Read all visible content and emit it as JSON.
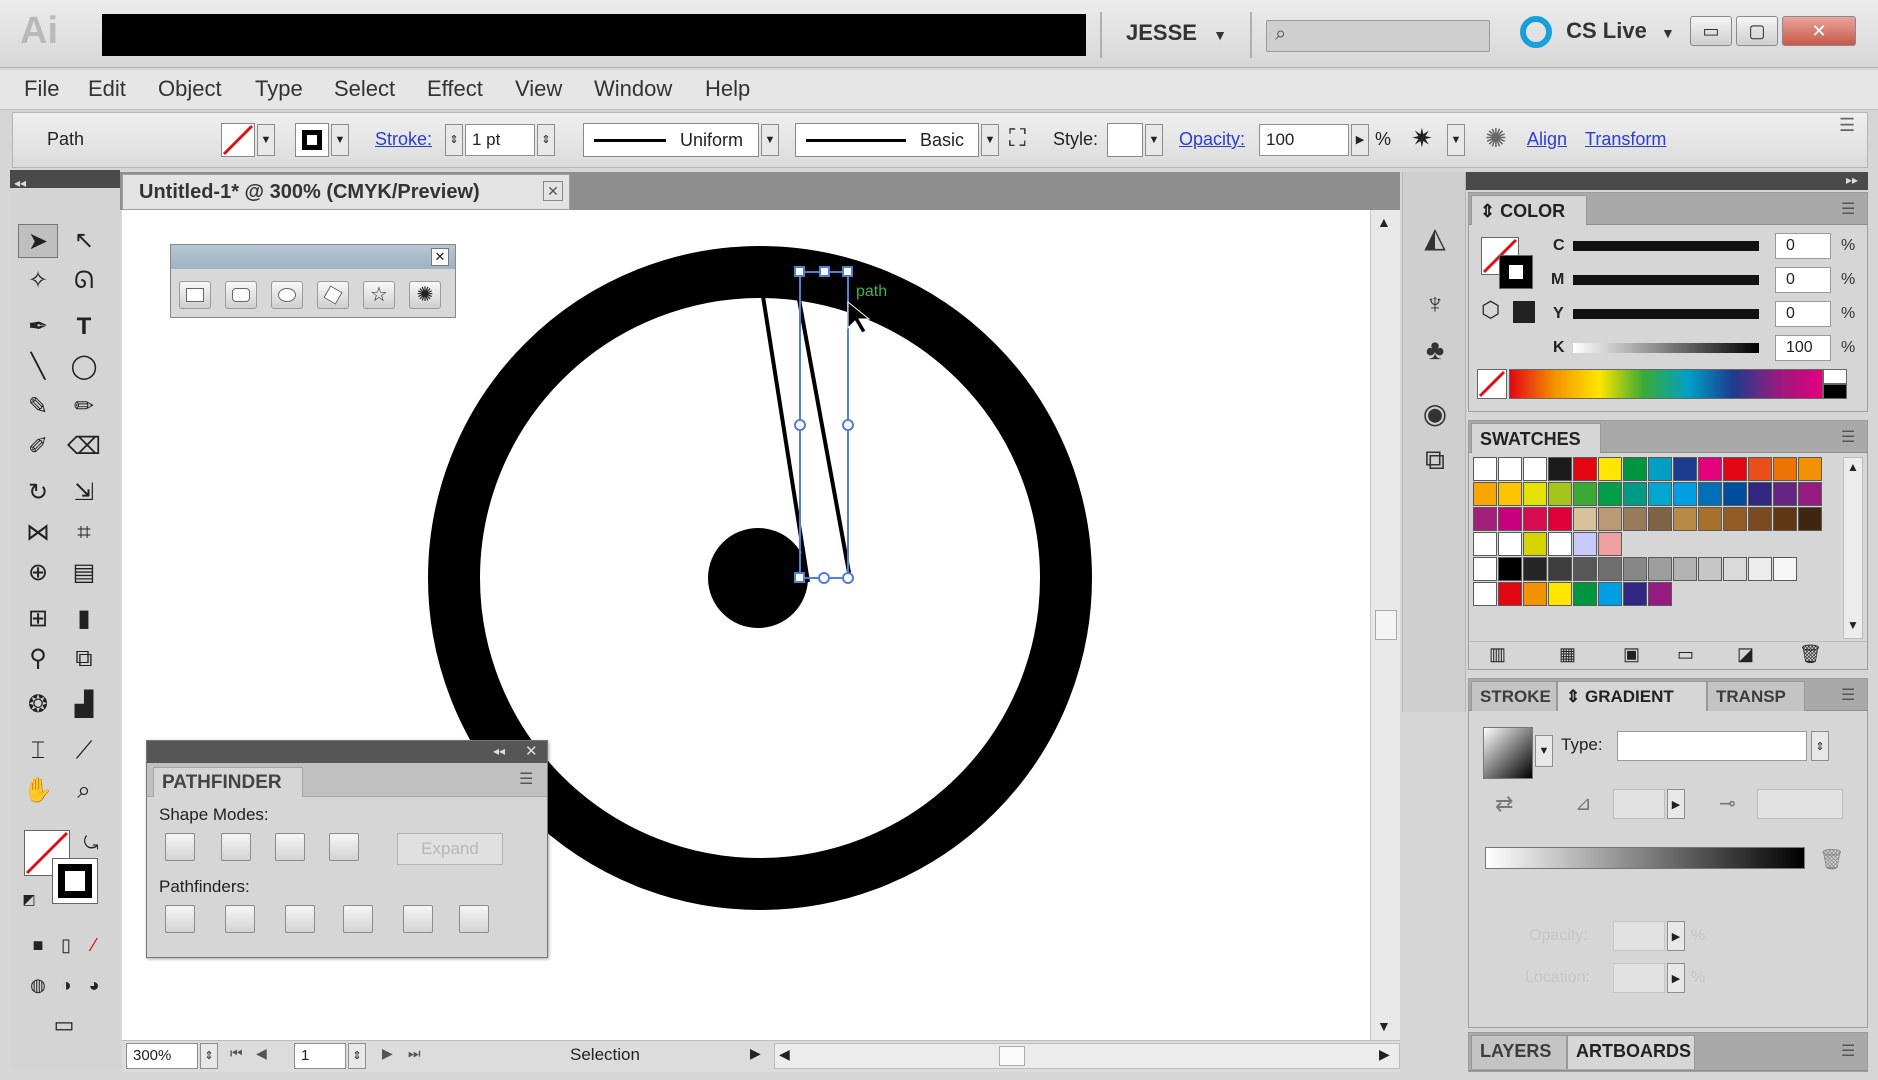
{
  "app": {
    "logo": "Ai",
    "user": "JESSE",
    "cs_live": "CS Live",
    "window_buttons": {
      "minimize": "▭",
      "restore": "▢",
      "close": "✕"
    }
  },
  "menu": [
    "File",
    "Edit",
    "Object",
    "Type",
    "Select",
    "Effect",
    "View",
    "Window",
    "Help"
  ],
  "control_bar": {
    "selection_label": "Path",
    "stroke_label": "Stroke:",
    "stroke_weight": "1 pt",
    "profile_label": "Uniform",
    "brush_label": "Basic",
    "style_label": "Style:",
    "opacity_label": "Opacity:",
    "opacity_value": "100",
    "opacity_unit": "%",
    "align_label": "Align",
    "transform_label": "Transform"
  },
  "document": {
    "tab_title": "Untitled-1* @ 300% (CMYK/Preview)",
    "tab_close": "✕",
    "smart_guide_label": "path"
  },
  "status_bar": {
    "zoom": "300%",
    "artboard_number": "1",
    "current_tool": "Selection"
  },
  "pathfinder": {
    "tab_label": "PATHFINDER",
    "shape_modes_label": "Shape Modes:",
    "pathfinders_label": "Pathfinders:",
    "expand_label": "Expand"
  },
  "color_panel": {
    "tab_label": "COLOR",
    "channels": [
      {
        "label": "C",
        "value": "0",
        "unit": "%"
      },
      {
        "label": "M",
        "value": "0",
        "unit": "%"
      },
      {
        "label": "Y",
        "value": "0",
        "unit": "%"
      },
      {
        "label": "K",
        "value": "100",
        "unit": "%"
      }
    ]
  },
  "swatches_panel": {
    "tab_label": "SWATCHES",
    "rows": [
      [
        "#ffffff",
        "#ffffff",
        "#ffffff",
        "#1a1a1a",
        "#e30613",
        "#ffe600",
        "#00963f",
        "#00a0c6",
        "#1d3c8f",
        "#e5007d",
        "#e30613",
        "#e94e1b",
        "#ee7203",
        "#f39200"
      ],
      [
        "#f7a600",
        "#fdc400",
        "#e6e200",
        "#a6c51a",
        "#3aaa35",
        "#00a04a",
        "#009a85",
        "#00a8cf",
        "#009fe3",
        "#0070b8",
        "#004f9f",
        "#312783",
        "#662483",
        "#951b81"
      ],
      [
        "#a41f7a",
        "#c6007e",
        "#d60b52",
        "#e2003a",
        "#d7c29c",
        "#b99976",
        "#977b5c",
        "#7e6344",
        "#b78b45",
        "#a86f2d",
        "#935c27",
        "#7c4a20",
        "#5f3813",
        "#3e2610"
      ],
      [
        "#ffffff",
        "#ffffff",
        "#d8d400",
        "#ffffff",
        "#c9c9ff",
        "#f0a0a0"
      ],
      [
        "#ffffff",
        "#000000",
        "#262626",
        "#3d3d3d",
        "#575757",
        "#6f6f6f",
        "#878787",
        "#9d9d9d",
        "#b2b2b2",
        "#c6c6c6",
        "#dadada",
        "#ececec",
        "#f6f6f6"
      ],
      [
        "#ffffff",
        "#e30613",
        "#f39200",
        "#ffe600",
        "#00963f",
        "#009fe3",
        "#312783",
        "#951b81"
      ]
    ]
  },
  "gradient_panel": {
    "tabs": [
      "STROKE",
      "GRADIENT",
      "TRANSP"
    ],
    "type_label": "Type:",
    "opacity_label": "Opacity:",
    "location_label": "Location:"
  },
  "bottom_panel": {
    "tabs": [
      "LAYERS",
      "ARTBOARDS"
    ]
  }
}
